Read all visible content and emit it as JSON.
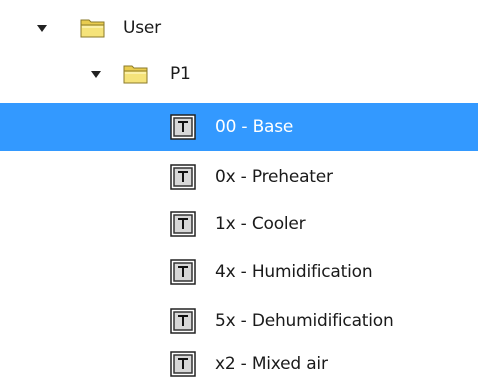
{
  "tree": {
    "root": {
      "label": "User",
      "expanded": true,
      "icon": "folder-icon",
      "children": [
        {
          "label": "P1",
          "expanded": true,
          "icon": "folder-icon",
          "items": [
            {
              "label": "00 - Base",
              "icon": "template-icon",
              "selected": true
            },
            {
              "label": "0x - Preheater",
              "icon": "template-icon",
              "selected": false
            },
            {
              "label": "1x - Cooler",
              "icon": "template-icon",
              "selected": false
            },
            {
              "label": "4x - Humidification",
              "icon": "template-icon",
              "selected": false
            },
            {
              "label": "5x - Dehumidification",
              "icon": "template-icon",
              "selected": false
            },
            {
              "label": "x2 - Mixed air",
              "icon": "template-icon",
              "selected": false
            }
          ]
        }
      ]
    },
    "colors": {
      "selection": "#3399ff",
      "selection_text": "#ffffff",
      "folder": "#f2dd6b"
    }
  }
}
